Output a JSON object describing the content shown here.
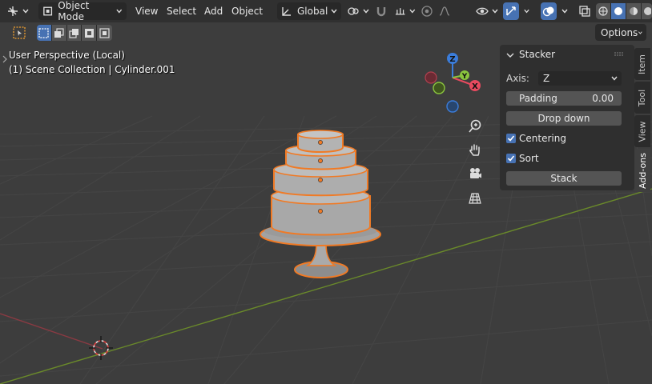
{
  "header": {
    "mode": "Object Mode",
    "menus": [
      "View",
      "Select",
      "Add",
      "Object"
    ],
    "orientation": "Global",
    "options": "Options"
  },
  "viewport": {
    "perspective": "User Perspective (Local)",
    "collection": "(1) Scene Collection | Cylinder.001"
  },
  "gizmo": {
    "x": "X",
    "y": "Y",
    "z": "Z"
  },
  "panel": {
    "title": "Stacker",
    "axis_label": "Axis:",
    "axis_value": "Z",
    "padding_label": "Padding",
    "padding_value": "0.00",
    "drop_down": "Drop down",
    "centering": "Centering",
    "sort": "Sort",
    "stack": "Stack"
  },
  "tabs": [
    "Item",
    "Tool",
    "View",
    "Add-ons"
  ],
  "colors": {
    "accent": "#4772b3",
    "selection_outline": "#f07a25",
    "axis_x": "#e84a5f",
    "axis_y": "#8bc53e",
    "axis_z": "#3b7ddb"
  }
}
